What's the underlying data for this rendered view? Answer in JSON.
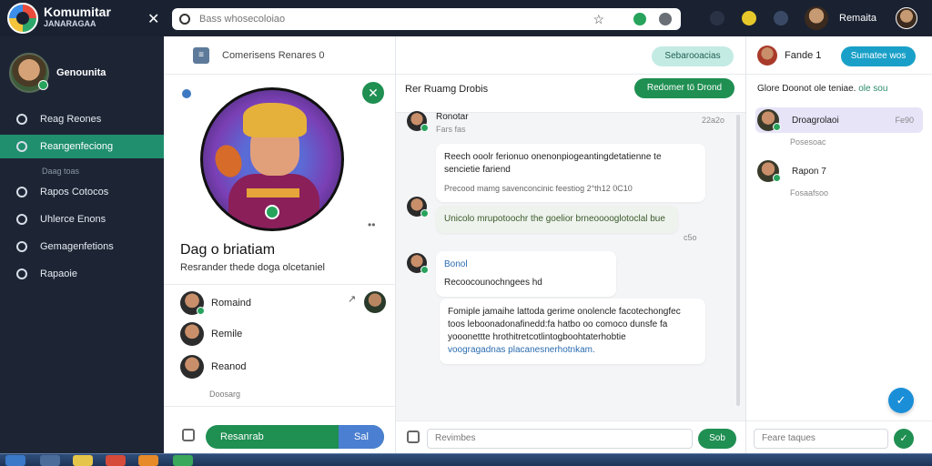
{
  "brand": {
    "name": "Komumitar",
    "sub": "JANARAGAA"
  },
  "search": {
    "placeholder": "Bass whosecoloiao"
  },
  "topbar": {
    "user_name": "Remaita"
  },
  "sidebar": {
    "user_name": "Genounita",
    "items": [
      {
        "label": "Reag Reones",
        "active": false
      },
      {
        "label": "Reangenfeciong",
        "active": true
      },
      {
        "label": "Rapos Cotocos",
        "active": false
      },
      {
        "label": "Uhlerce Enons",
        "active": false
      },
      {
        "label": "Gemagenfetions",
        "active": false
      },
      {
        "label": "Rapaoie",
        "active": false
      }
    ],
    "sub_label": "Daag toas"
  },
  "profile": {
    "header": "Comerisens  Renares  0",
    "name": "Dag o briatiam",
    "description": "Resrander thede doga olcetaniel",
    "friends": [
      {
        "name": "Romaind"
      },
      {
        "name": "Remile"
      },
      {
        "name": "Reanod"
      }
    ],
    "more": "Doosarg",
    "button": "Resanrab",
    "button_seg": "Sal"
  },
  "chat": {
    "header_tab": "Sebarooacias",
    "title": "Rer Ruamg Drobis",
    "header_button": "Redomer tö Drond",
    "messages": [
      {
        "sender": "Ronotar",
        "time": "22a2o",
        "sub": "Fars fas"
      },
      {
        "text": "Reech ooolr ferionuo onenonpiogeantingdetatienne te sencietie fariend",
        "sub": "Precood mamg savenconcinic feestiog  2°th12 0C10"
      },
      {
        "text": "Unicolo mrupotoochr the goelior brneooooglotoclal bue",
        "time": "c5o"
      },
      {
        "sender": "Bonol",
        "text": "Recoocounochngees hd"
      },
      {
        "text": "Fomiple jamaihe lattoda gerime onolencle facotechongfec toos leboonadonafinedd:fa hatbo oo comoco dunsfe fa yooonettte hrothitretcotlintogboohtaterhobtie",
        "link": "voogragadnas placanesnerhotnkam."
      }
    ],
    "input_placeholder": "Revimbes",
    "send": "Sob"
  },
  "right": {
    "name": "Fande 1",
    "button": "Sumatee wos",
    "title": "Glore  Doonot ole teniae.",
    "title_link": "ole sou",
    "contacts": [
      {
        "name": "Droagrolaoi",
        "time": "Fe90",
        "sub": "Posesoac",
        "selected": true
      },
      {
        "name": "Rapon 7",
        "time": "",
        "sub": "Fosaafsoo",
        "selected": false
      }
    ],
    "input_placeholder": "Feare taques"
  },
  "colors": {
    "accent_green": "#1f8f52",
    "accent_blue": "#1a8fd8",
    "sidebar_active": "#1f8f6e"
  }
}
